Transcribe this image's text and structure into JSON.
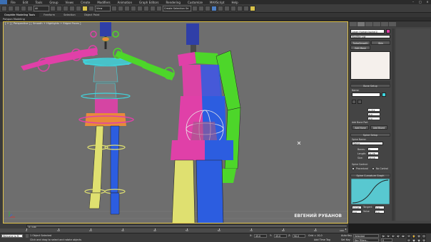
{
  "menubar": {
    "items": [
      "File",
      "Edit",
      "Tools",
      "Group",
      "Views",
      "Create",
      "Modifiers",
      "Animation",
      "Graph Editors",
      "Rendering",
      "Customize",
      "MAXScript",
      "Help"
    ]
  },
  "toolbar": {
    "selection_filter": "All",
    "view_dropdown": "View",
    "named_selection": "Create Selection Se"
  },
  "ribbon": {
    "tabs": [
      "Graphite Modeling Tools",
      "Freeform",
      "Selection",
      "Object Paint"
    ],
    "subtab": "Polygon Modeling"
  },
  "viewport": {
    "label": "[ + ] [ Perspective ] [ Smooth + Highlights + Edged Faces ]",
    "watermark": "ЕВГЕНИЙ РУБАНОВ"
  },
  "command_panel": {
    "object_name": "Laser Human(spine1)",
    "modifier_list": "Modifier List",
    "buttons_top": [
      "TurboSmooth",
      "Skin",
      "Edit Mesh"
    ],
    "rollout_bone_setup": "Bone Setup",
    "name_label": "Name:",
    "name_value": "",
    "spinners": [
      {
        "label": "",
        "value": "1.711"
      },
      {
        "label": "",
        "value": "0.0"
      },
      {
        "label": "",
        "value": "2.0"
      }
    ],
    "add_bone_part": "Add Bone Part",
    "add_none": "Add None",
    "add_bipedal": "Add Biped",
    "rollout_spine_setup": "Spine Setup",
    "spine_name_label": "Spine Name:",
    "spine_name": "Spine",
    "bones_label": "Bones:",
    "bones_value": "1",
    "length_label": "Length:",
    "length_value": "11.78",
    "size_label": "Size:",
    "size_value": "40.18",
    "spine_control_label": "Spine Control:",
    "procedural_label": "Procedural",
    "no_control_label": "No Control",
    "rollout_curvature": "Spine Curvature Graph",
    "tangent_label": "Tangent",
    "value_label": "Value",
    "graph_values": [
      "0.143",
      "0.0",
      "0.0",
      "0.0"
    ]
  },
  "timeline": {
    "slider_text": "0 / 100",
    "ruler_labels": [
      "0",
      "10",
      "20",
      "30",
      "40",
      "50",
      "60",
      "70",
      "80",
      "90",
      "100"
    ]
  },
  "status": {
    "maxscript_label": "Welcome to M",
    "selection_info": "1 Object Selected",
    "prompt": "Click and drag to select and rotate objects",
    "x_label": "X:",
    "x_value": "45.0",
    "y_label": "Y:",
    "y_value": "45.0",
    "z_label": "Z:",
    "z_value": "90.0",
    "grid": "Grid = 10,0",
    "add_time_tag": "Add Time Tag",
    "auto_key": "Auto Key",
    "auto_key_value": "Selected",
    "set_key": "Set Key",
    "key_filters": "Key Filters...",
    "frame_value": "0"
  },
  "colors": {
    "magenta": "#e040a8",
    "green": "#4dd62a",
    "cyan": "#3fd7e0",
    "yellow": "#dfe070",
    "blue": "#2c5de0",
    "orange": "#e88a3a",
    "viewport_bg": "#6e6e6e",
    "panel_bg": "#444444"
  }
}
